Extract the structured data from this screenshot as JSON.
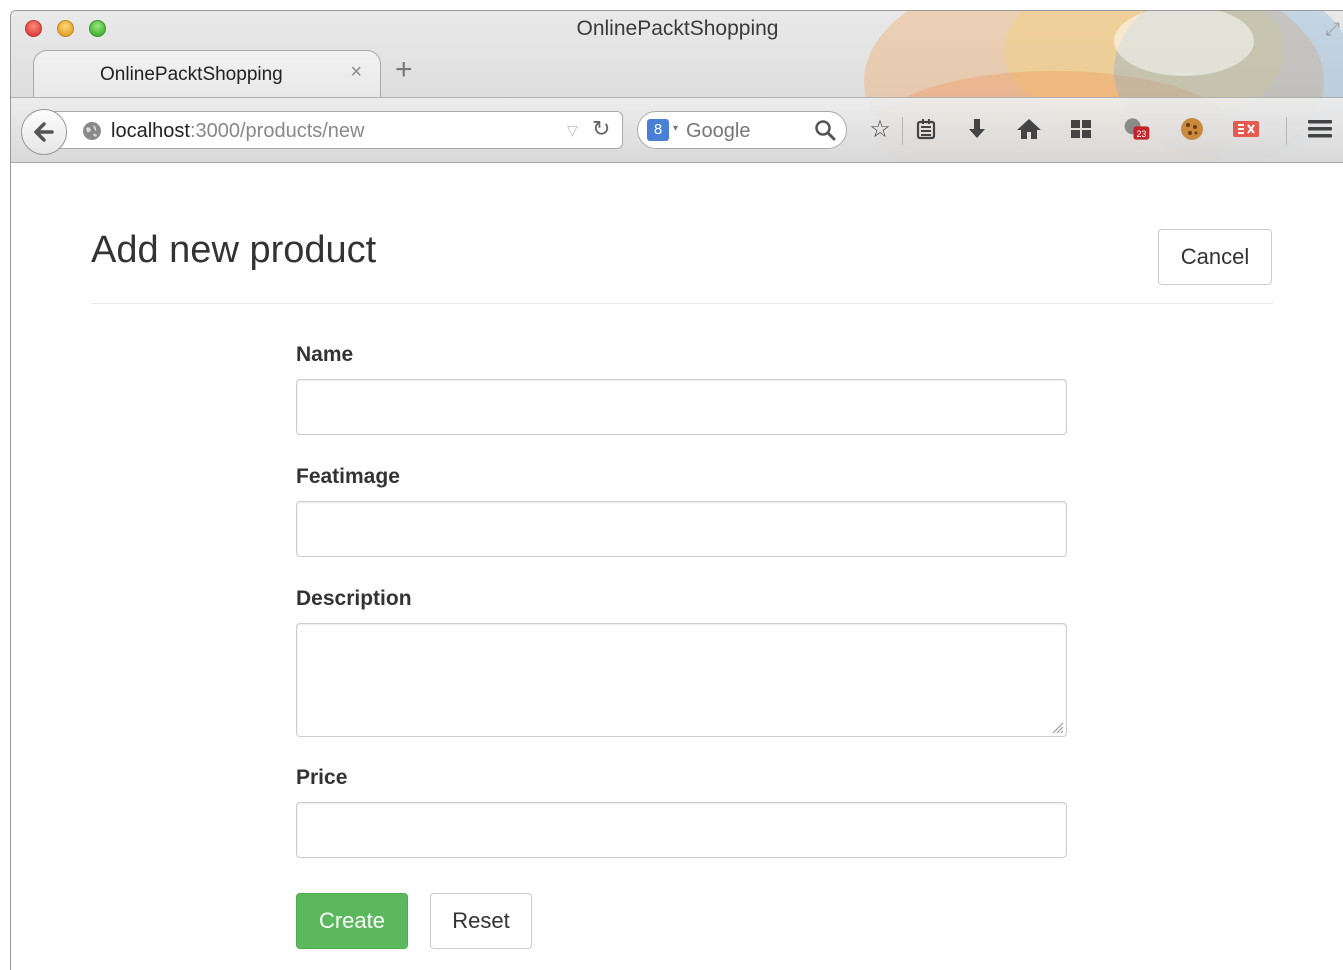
{
  "window": {
    "title": "OnlinePacktShopping"
  },
  "tab": {
    "title": "OnlinePacktShopping",
    "close_glyph": "×",
    "new_tab_glyph": "+"
  },
  "urlbar": {
    "host": "localhost",
    "path": ":3000/products/new"
  },
  "searchbar": {
    "engine": "Google",
    "engine_glyph": "8",
    "placeholder": "Google"
  },
  "toolbar_icons": [
    "star-icon",
    "reading-list-icon",
    "download-icon",
    "home-icon",
    "apps-icon",
    "notification-icon",
    "cookie-icon",
    "extension-icon",
    "menu-icon"
  ],
  "notification_badge": "23",
  "page": {
    "title": "Add new product",
    "cancel_label": "Cancel"
  },
  "form": {
    "fields": [
      {
        "label": "Name",
        "value": "",
        "type": "text"
      },
      {
        "label": "Featimage",
        "value": "",
        "type": "text"
      },
      {
        "label": "Description",
        "value": "",
        "type": "textarea"
      },
      {
        "label": "Price",
        "value": "",
        "type": "text"
      }
    ],
    "create_label": "Create",
    "reset_label": "Reset"
  },
  "colors": {
    "primary_button": "#5cb85c",
    "border": "#cccccc",
    "text": "#333333"
  }
}
